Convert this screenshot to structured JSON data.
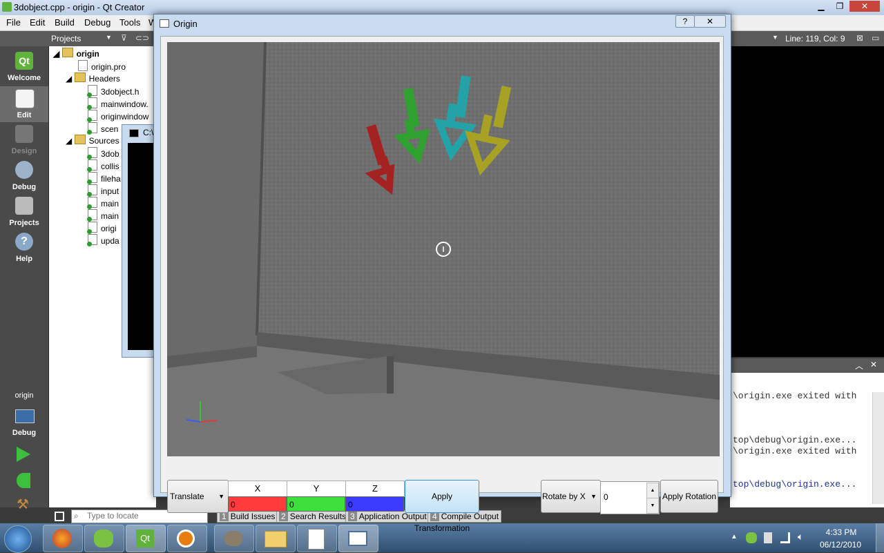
{
  "qt": {
    "title": "3dobject.cpp - origin - Qt Creator",
    "menu": [
      "File",
      "Edit",
      "Build",
      "Debug",
      "Tools",
      "W"
    ],
    "projects_label": "Projects",
    "line_col": "Line: 119, Col: 9",
    "modes": [
      {
        "label": "Welcome",
        "icon": "qt-logo-icon"
      },
      {
        "label": "Edit",
        "icon": "edit-document-icon"
      },
      {
        "label": "Design",
        "icon": "design-tools-icon"
      },
      {
        "label": "Debug",
        "icon": "debug-bug-icon"
      },
      {
        "label": "Projects",
        "icon": "projects-book-icon"
      },
      {
        "label": "Help",
        "icon": "help-icon"
      }
    ],
    "target": {
      "project": "origin",
      "config": "Debug"
    },
    "tree": {
      "root": "origin",
      "pro": "origin.pro",
      "headers_label": "Headers",
      "headers": [
        "3dobject.h",
        "mainwindow.",
        "originwindow",
        "scen"
      ],
      "sources_label": "Sources",
      "sources": [
        "3dob",
        "collis",
        "fileha",
        "input",
        "main",
        "main",
        "origi",
        "upda"
      ]
    },
    "console_title": "C:\\",
    "output_lines": [
      "\\origin.exe exited with",
      "top\\debug\\origin.exe...",
      "\\origin.exe exited with",
      "top\\debug\\origin.exe..."
    ],
    "locate_placeholder": "Type to locate",
    "output_tabs": [
      {
        "n": "1",
        "label": "Build Issues"
      },
      {
        "n": "2",
        "label": "Search Results"
      },
      {
        "n": "3",
        "label": "Application Output"
      },
      {
        "n": "4",
        "label": "Compile Output"
      }
    ]
  },
  "origin": {
    "title": "Origin",
    "mode_select": "Translate",
    "axes": [
      {
        "label": "X",
        "value": "0",
        "color": "#ff3b3b"
      },
      {
        "label": "Y",
        "value": "0",
        "color": "#3ddf3d"
      },
      {
        "label": "Z",
        "value": "0",
        "color": "#3b3bff"
      }
    ],
    "apply_transformation": "Apply Transformation",
    "rotate_select": "Rotate by X",
    "rotation_value": "0",
    "apply_rotation": "Apply Rotation"
  },
  "taskbar": {
    "time": "4:33 PM",
    "date": "06/12/2010"
  },
  "colors": {
    "arrow_red": "#a52222",
    "arrow_green": "#2ea12e",
    "arrow_cyan": "#23a3a8",
    "arrow_yellow": "#a8a224"
  }
}
